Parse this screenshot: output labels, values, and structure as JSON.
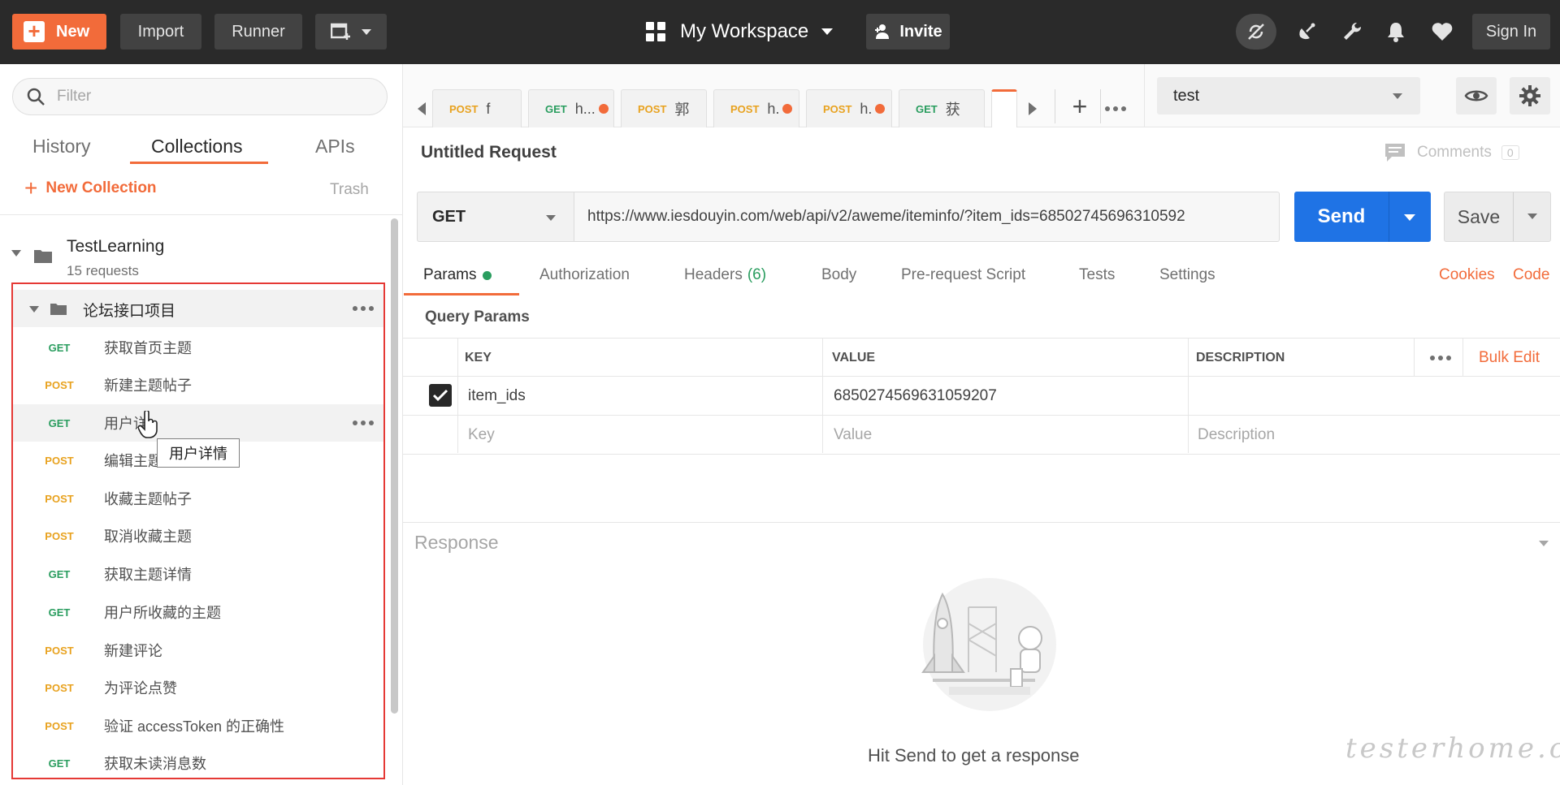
{
  "topbar": {
    "new_label": "New",
    "import_label": "Import",
    "runner_label": "Runner",
    "workspace_label": "My Workspace",
    "invite_label": "Invite",
    "signin_label": "Sign In"
  },
  "sidebar": {
    "filter_placeholder": "Filter",
    "tabs": [
      {
        "label": "History"
      },
      {
        "label": "Collections"
      },
      {
        "label": "APIs"
      }
    ],
    "new_collection_label": "New Collection",
    "trash_label": "Trash",
    "collection": {
      "name": "TestLearning",
      "count": "15 requests"
    },
    "folder": {
      "name": "论坛接口项目"
    },
    "requests": [
      {
        "method": "GET",
        "name": "获取首页主题"
      },
      {
        "method": "POST",
        "name": "新建主题帖子"
      },
      {
        "method": "GET",
        "name": "用户详"
      },
      {
        "method": "POST",
        "name": "编辑主题"
      },
      {
        "method": "POST",
        "name": "收藏主题帖子"
      },
      {
        "method": "POST",
        "name": "取消收藏主题"
      },
      {
        "method": "GET",
        "name": "获取主题详情"
      },
      {
        "method": "GET",
        "name": "用户所收藏的主题"
      },
      {
        "method": "POST",
        "name": "新建评论"
      },
      {
        "method": "POST",
        "name": "为评论点赞"
      },
      {
        "method": "POST",
        "name": "验证 accessToken 的正确性"
      },
      {
        "method": "GET",
        "name": "获取未读消息数"
      }
    ],
    "tooltip": "用户详情"
  },
  "tabs": [
    {
      "method": "POST",
      "title": "f"
    },
    {
      "method": "GET",
      "title": "h..."
    },
    {
      "method": "POST",
      "title": "郭"
    },
    {
      "method": "POST",
      "title": "h."
    },
    {
      "method": "POST",
      "title": "h."
    },
    {
      "method": "GET",
      "title": "获"
    }
  ],
  "environment": {
    "selected": "test"
  },
  "request": {
    "title": "Untitled Request",
    "comments_label": "Comments",
    "comments_count": "0",
    "method": "GET",
    "url": "https://www.iesdouyin.com/web/api/v2/aweme/iteminfo/?item_ids=68502745696310592",
    "send_label": "Send",
    "save_label": "Save"
  },
  "subtabs": {
    "params": "Params",
    "authorization": "Authorization",
    "headers": "Headers",
    "headers_count": "(6)",
    "body": "Body",
    "prerequest": "Pre-request Script",
    "tests": "Tests",
    "settings": "Settings",
    "cookies": "Cookies",
    "code": "Code"
  },
  "params": {
    "title": "Query Params",
    "headers": {
      "key": "KEY",
      "value": "VALUE",
      "description": "DESCRIPTION",
      "bulk_edit": "Bulk Edit"
    },
    "rows": [
      {
        "key": "item_ids",
        "value": "6850274569631059207",
        "description": ""
      }
    ],
    "placeholders": {
      "key": "Key",
      "value": "Value",
      "description": "Description"
    }
  },
  "response": {
    "title": "Response",
    "empty_message": "Hit Send to get a response"
  },
  "watermark": "testerhome.com",
  "colors": {
    "accent": "#f26b3a",
    "send": "#1f73e5",
    "get": "#2a9d5f",
    "post": "#e8a21f"
  }
}
